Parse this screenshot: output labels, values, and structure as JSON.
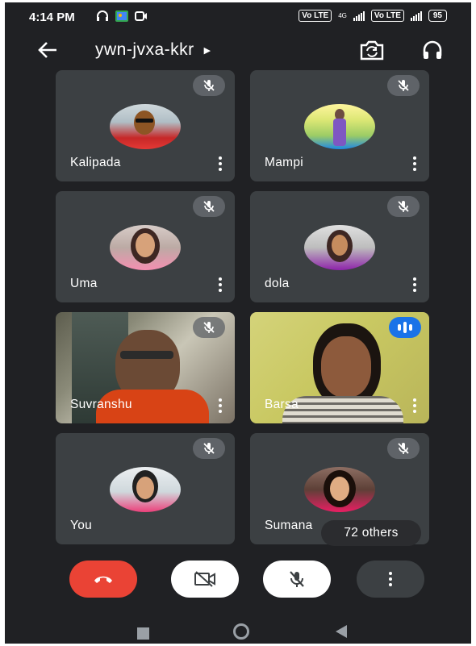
{
  "status_bar": {
    "time": "4:14 PM",
    "left_icons": [
      "headset-icon",
      "gallery-icon",
      "screen-record-icon"
    ],
    "sim1_badge": "Vo LTE",
    "network": "4G",
    "sim2_badge": "Vo LTE",
    "battery": "95"
  },
  "meeting": {
    "code": "ywn-jvxa-kkr"
  },
  "participants": [
    {
      "name": "Kalipada",
      "muted": true,
      "video": false
    },
    {
      "name": "Mampi",
      "muted": true,
      "video": false
    },
    {
      "name": "Uma",
      "muted": true,
      "video": false
    },
    {
      "name": "dola",
      "muted": true,
      "video": false
    },
    {
      "name": "Suvranshu",
      "muted": true,
      "video": true
    },
    {
      "name": "Barsa",
      "muted": false,
      "speaking": true,
      "video": true
    },
    {
      "name": "You",
      "muted": true,
      "video": false
    },
    {
      "name": "Sumana",
      "muted": true,
      "video": false
    }
  ],
  "others_label": "72 others",
  "controls": [
    "end-call-icon",
    "camera-off-icon",
    "mic-off-icon",
    "more-vert-icon"
  ],
  "colors": {
    "background": "#202124",
    "tile": "#3c4043",
    "end_call": "#ea4335",
    "speaking": "#1a73e8"
  }
}
